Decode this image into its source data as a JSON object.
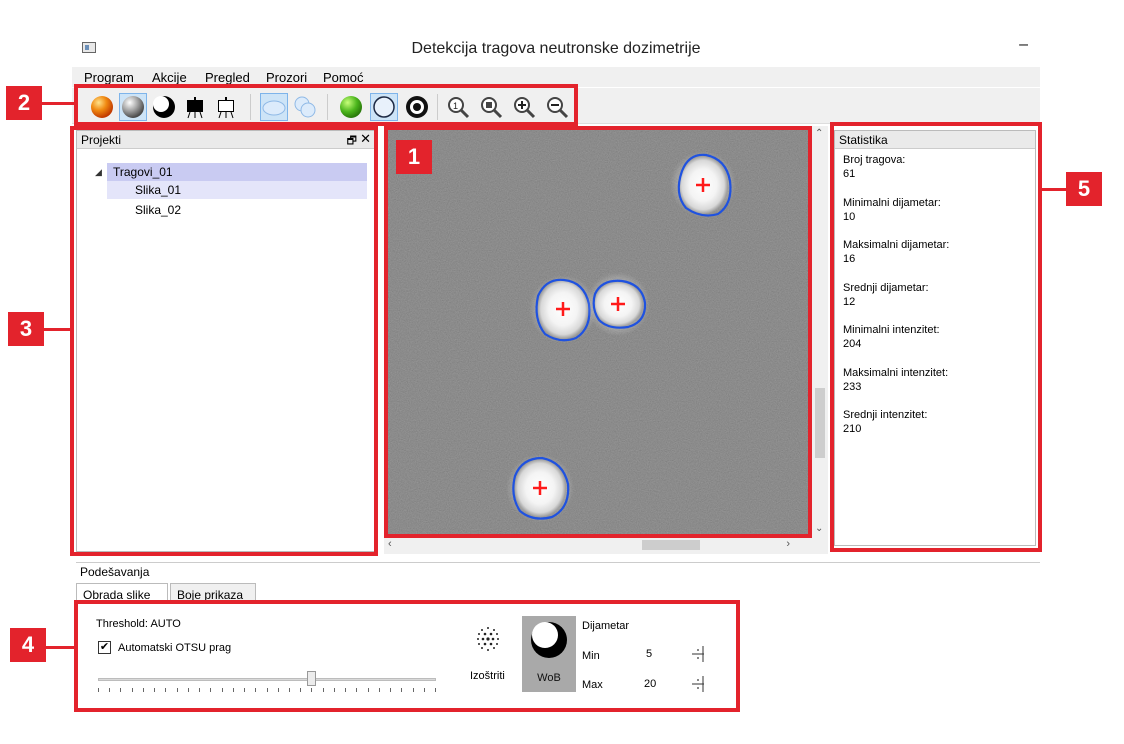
{
  "window": {
    "title": "Detekcija tragova neutronske dozimetrije",
    "minimize": "–"
  },
  "menu": [
    "Program",
    "Akcije",
    "Pregled",
    "Prozori",
    "Pomoć"
  ],
  "toolbar_icons": [
    "orange-sphere",
    "grey-sphere",
    "black-white-circle",
    "easel-filled",
    "easel-empty",
    "ellipse",
    "blob-shapes",
    "green-circle",
    "circle-outline",
    "ring-target",
    "zoom-1",
    "zoom-fit",
    "zoom-in",
    "zoom-out"
  ],
  "projects": {
    "title": "Projekti",
    "float": "🗗",
    "close": "✕",
    "root": "Tragovi_01",
    "children": [
      "Slika_01",
      "Slika_02"
    ]
  },
  "stats": {
    "title": "Statistika",
    "items": [
      {
        "label": "Broj tragova:",
        "value": "61"
      },
      {
        "label": "Minimalni dijametar:",
        "value": "10"
      },
      {
        "label": "Maksimalni dijametar:",
        "value": "16"
      },
      {
        "label": "Srednji dijametar:",
        "value": "12"
      },
      {
        "label": "Minimalni intenzitet:",
        "value": "204"
      },
      {
        "label": "Maksimalni intenzitet:",
        "value": "233"
      },
      {
        "label": "Srednji intenzitet:",
        "value": "210"
      }
    ]
  },
  "settings": {
    "title": "Podešavanja",
    "tabs": [
      "Obrada slike",
      "Boje prikaza"
    ],
    "threshold_label": "Threshold:",
    "threshold_value": "AUTO",
    "otsu_label": "Automatski OTSU prag",
    "otsu_checked": true,
    "sharpen_label": "Izoštriti",
    "wob_label": "WoB",
    "diameter_label": "Dijametar",
    "min_label": "Min",
    "min_value": "5",
    "max_label": "Max",
    "max_value": "20",
    "slider_position": 0.63
  },
  "callouts": [
    "1",
    "2",
    "3",
    "4",
    "5"
  ],
  "colors": {
    "callout": "#e3232c",
    "track_outline": "#1f52e0",
    "track_center": "#ff1a1a",
    "selection": "#c9cbf2"
  }
}
